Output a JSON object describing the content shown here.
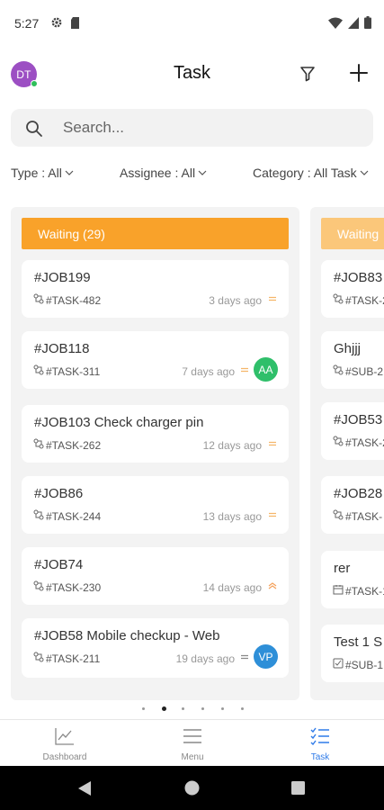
{
  "status_bar": {
    "time": "5:27"
  },
  "header": {
    "avatar_initials": "DT",
    "title": "Task"
  },
  "search": {
    "placeholder": "Search..."
  },
  "filters": [
    {
      "label": "Type : All"
    },
    {
      "label": "Assignee : All"
    },
    {
      "label": "Category : All Task"
    }
  ],
  "columns": [
    {
      "header": "Waiting (29)",
      "color": "#f9a22a",
      "cards": [
        {
          "title": "#JOB199",
          "task": "#TASK-482",
          "time": "3 days ago",
          "priority": "medium",
          "assignee": ""
        },
        {
          "title": "#JOB118",
          "task": "#TASK-311",
          "time": "7 days ago",
          "priority": "medium",
          "assignee": "AA",
          "assignee_color": "#2fbf6a"
        },
        {
          "title": "#JOB103 Check charger pin",
          "task": "#TASK-262",
          "time": "12 days ago",
          "priority": "medium",
          "assignee": ""
        },
        {
          "title": "#JOB86",
          "task": "#TASK-244",
          "time": "13 days ago",
          "priority": "medium",
          "assignee": ""
        },
        {
          "title": "#JOB74",
          "task": "#TASK-230",
          "time": "14 days ago",
          "priority": "high",
          "assignee": ""
        },
        {
          "title": "#JOB58 Mobile checkup - Web",
          "task": "#TASK-211",
          "time": "19 days ago",
          "priority": "low",
          "assignee": "VP",
          "assignee_color": "#2e8fd8"
        }
      ]
    },
    {
      "header": "Waiting",
      "color": "#fbc77a",
      "cards": [
        {
          "title": "#JOB83",
          "task": "#TASK-2"
        },
        {
          "title": "Ghjjj",
          "task": "#SUB-2"
        },
        {
          "title": "#JOB53",
          "task": "#TASK-2"
        },
        {
          "title": "#JOB28",
          "task": "#TASK-"
        },
        {
          "title": "rer",
          "task": "#TASK-1"
        },
        {
          "title": "Test 1 S",
          "task": "#SUB-1"
        }
      ]
    }
  ],
  "pager": {
    "count": 6,
    "active": 1
  },
  "bottom_nav": [
    {
      "label": "Dashboard",
      "icon": "chart-icon"
    },
    {
      "label": "Menu",
      "icon": "menu-icon"
    },
    {
      "label": "Task",
      "icon": "tasklist-icon",
      "active": true
    }
  ]
}
